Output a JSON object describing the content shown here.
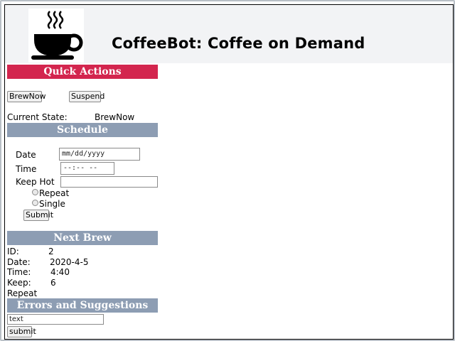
{
  "header": {
    "title": "CoffeeBot: Coffee on Demand",
    "logo": "coffee-cup-icon"
  },
  "quick_actions": {
    "heading": "Quick Actions",
    "brew_button": "BrewNow",
    "suspend_button": "Suspend",
    "state_label": "Current State:",
    "state_value": "BrewNow"
  },
  "schedule": {
    "heading": "Schedule",
    "date_label": "Date",
    "date_placeholder": "mm/dd/yyyy",
    "time_label": "Time",
    "time_placeholder": "--:-- --",
    "keep_hot_label": "Keep Hot",
    "keep_hot_value": "",
    "repeat_label": "Repeat",
    "single_label": "Single",
    "submit_label": "Submit"
  },
  "next_brew": {
    "heading": "Next Brew",
    "id_label": "ID:",
    "id_value": "2",
    "date_label": "Date:",
    "date_value": "2020-4-5",
    "time_label": "Time:",
    "time_value": "4:40",
    "keep_label": "Keep:",
    "keep_value": "6",
    "mode": "Repeat"
  },
  "errors": {
    "heading": "Errors and Suggestions",
    "input_value": "text",
    "submit_label": "submit"
  },
  "colors": {
    "red": "#d3254e",
    "slate": "#8d9db3"
  }
}
